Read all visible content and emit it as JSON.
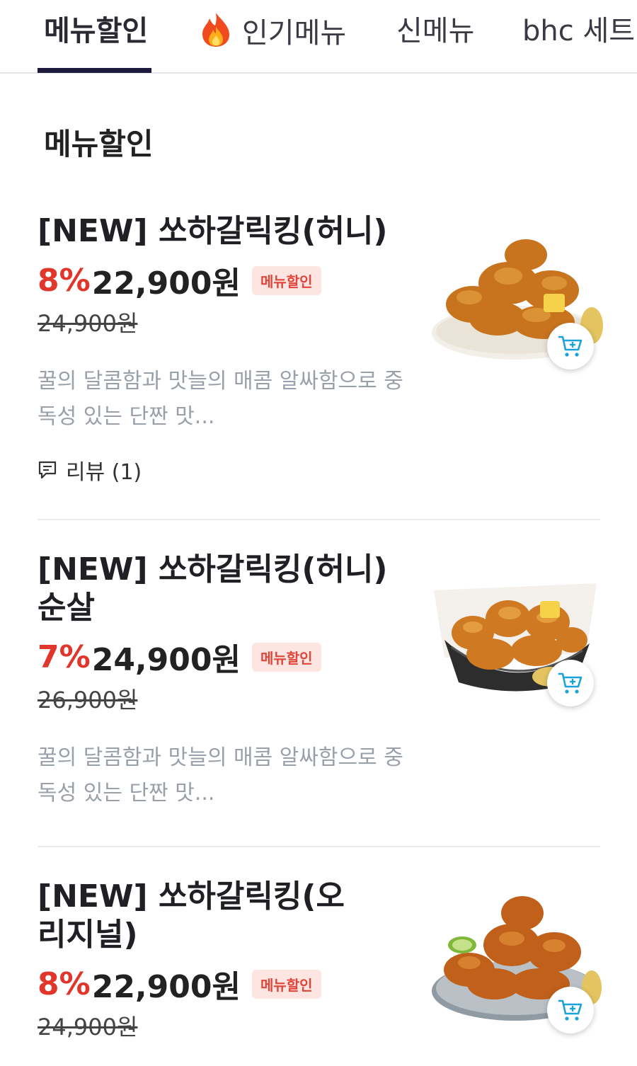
{
  "tabs": [
    {
      "label": "메뉴할인",
      "active": true
    },
    {
      "label": "인기메뉴",
      "icon": "fire-icon",
      "active": false
    },
    {
      "label": "신메뉴",
      "active": false
    },
    {
      "label": "bhc 세트",
      "active": false
    }
  ],
  "section": {
    "title": "메뉴할인"
  },
  "items": [
    {
      "name": "[NEW] 쏘하갈릭킹(허니)",
      "discount": "8%",
      "price": "22,900원",
      "badge": "메뉴할인",
      "original_price": "24,900원",
      "description": "꿀의 달콤함과 맛늘의 매콤 알싸함으로 중독성 있는 단짠 맛...",
      "review": "리뷰 (1)"
    },
    {
      "name": "[NEW] 쏘하갈릭킹(허니) 순살",
      "discount": "7%",
      "price": "24,900원",
      "badge": "메뉴할인",
      "original_price": "26,900원",
      "description": "꿀의 달콤함과 맛늘의 매콤 알싸함으로 중독성 있는 단짠 맛..."
    },
    {
      "name": "[NEW] 쏘하갈릭킹(오리지널)",
      "discount": "8%",
      "price": "22,900원",
      "badge": "메뉴할인",
      "original_price": "24,900원"
    }
  ],
  "colors": {
    "accent": "#e0362b",
    "tab_indicator": "#1d1a3d",
    "badge_bg": "#fde6e2",
    "cart_icon": "#1aa3d9"
  }
}
